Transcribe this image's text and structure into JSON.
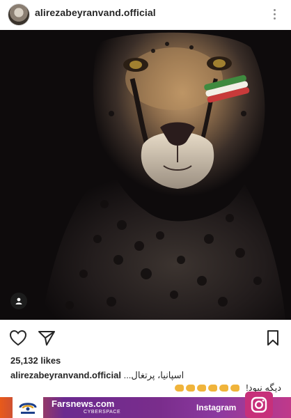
{
  "header": {
    "username": "alirezabeyranvand.official"
  },
  "post": {
    "likes": "25,132 likes",
    "caption_user": "alirezabeyranvand.official",
    "caption_text": "اسپانیا، پرتغال...",
    "caption_line2": "دیگه نبود!"
  },
  "watermark": {
    "brand": "Farsnews.com",
    "brand_sub": "CYBERSPACE",
    "platform": "Instagram"
  },
  "colors": {
    "accent_orange": "#e85a1a",
    "accent_purple": "#7a2d8c",
    "instagram_pink": "#c7307a"
  }
}
